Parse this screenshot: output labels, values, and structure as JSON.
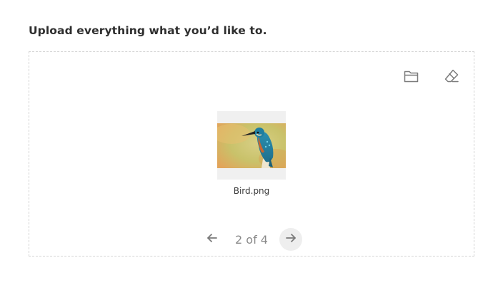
{
  "upload": {
    "heading": "Upload everything what you’d like to.",
    "toolbar": {
      "folder_icon": "folder-open-icon",
      "clear_icon": "eraser-icon"
    },
    "file": {
      "name": "Bird.png",
      "thumbnail": "kingfisher-bird-thumbnail"
    },
    "pagination": {
      "label": "2 of 4",
      "current": 2,
      "total": 4,
      "prev_icon": "arrow-left-icon",
      "next_icon": "arrow-right-icon"
    }
  },
  "colors": {
    "heading": "#2e2e2e",
    "border": "#d4d4d4",
    "icon": "#7a7a7a",
    "pager_text": "#8a8a8a",
    "pager_active_bg": "#eeeeee"
  }
}
